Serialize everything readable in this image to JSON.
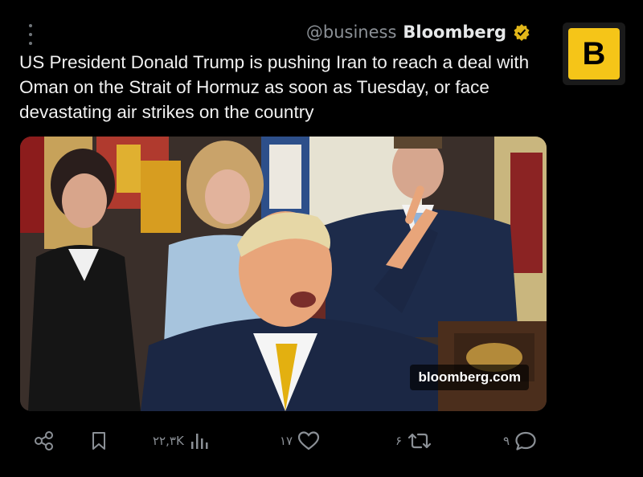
{
  "header": {
    "handle": "@business",
    "display_name": "Bloomberg",
    "avatar_letter": "B"
  },
  "tweet": {
    "text": "US President Donald Trump is pushing Iran to reach a deal with Oman on the Strait of Hormuz as soon as Tuesday, or face devastating air strikes on the country",
    "media_watermark": "bloomberg.com"
  },
  "actions": {
    "views": "۲۲,۳K",
    "likes": "۱۷",
    "reposts": "۶",
    "replies": "۹"
  },
  "colors": {
    "background": "#000000",
    "brand_yellow": "#f5c518",
    "badge_gold": "#e2b719",
    "muted": "#8b9096"
  }
}
